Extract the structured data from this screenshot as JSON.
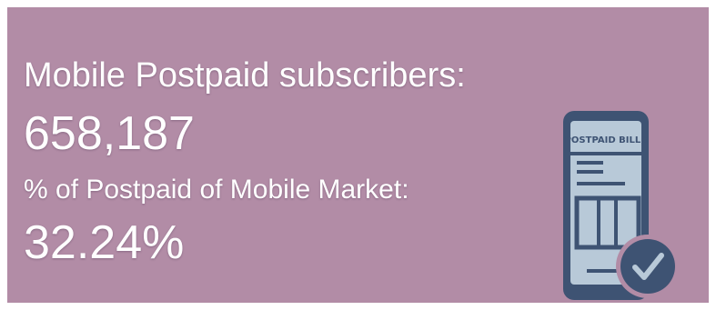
{
  "stats": {
    "subscribers_label": "Mobile Postpaid subscribers:",
    "subscribers_value": "658,187",
    "share_label": "% of Postpaid of Mobile Market:",
    "share_value": "32.24%"
  },
  "illustration": {
    "icon": "postpaid-bill-phone-icon",
    "badge_icon": "checkmark-badge-icon",
    "header_text": "POSTPAID BILLS"
  },
  "colors": {
    "background": "#b28ca6",
    "text": "#ffffff",
    "icon_dark": "#3e5373",
    "icon_fill": "#b8c9d8"
  }
}
